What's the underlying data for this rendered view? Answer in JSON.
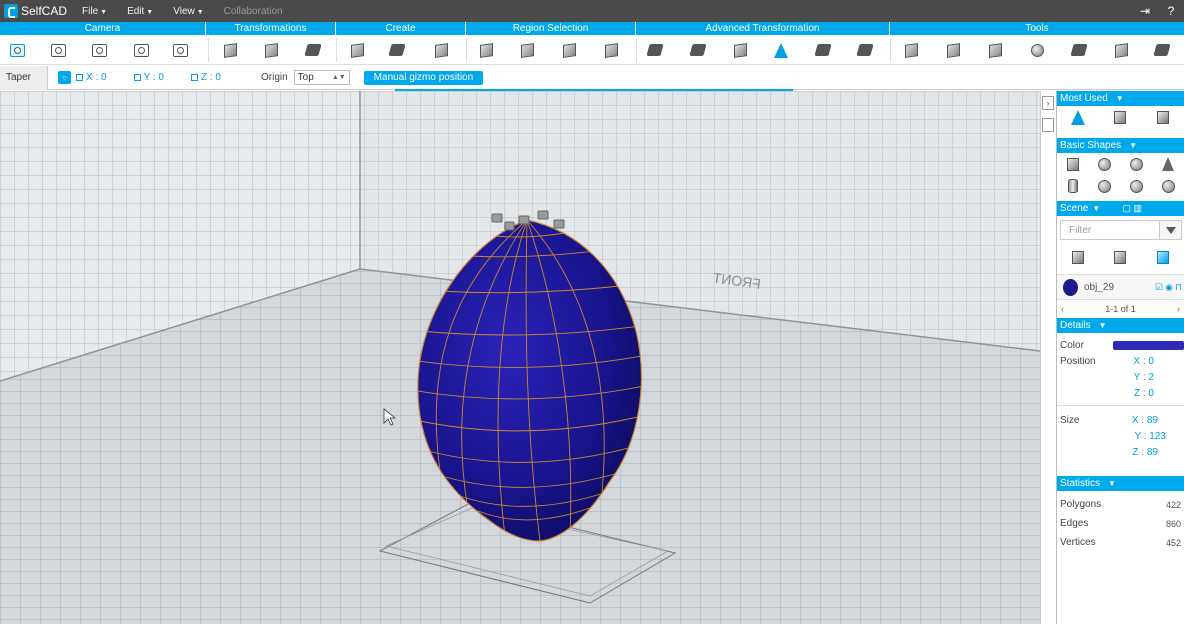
{
  "app": {
    "logo_text": "SelfCAD",
    "menu": [
      {
        "label": "File"
      },
      {
        "label": "Edit"
      },
      {
        "label": "View"
      },
      {
        "label": "Collaboration"
      }
    ]
  },
  "categories": [
    "Camera",
    "Transformations",
    "Create",
    "Region Selection",
    "Advanced Transformation",
    "Tools"
  ],
  "tool_options": {
    "tool_name": "Taper [J]",
    "axes": [
      "X : 0",
      "Y : 0",
      "Z : 0"
    ],
    "origin_label": "Origin",
    "origin_value": "Top",
    "gizmo_button": "Manual gizmo position"
  },
  "viewport": {
    "front_label": "FRONT"
  },
  "panel": {
    "most_used": "Most Used",
    "basic_shapes": "Basic Shapes",
    "scene": "Scene",
    "filter_placeholder": "Filter",
    "object_name": "obj_29",
    "pager_text": "1-1 of 1",
    "details": "Details",
    "color_label": "Color",
    "object_color": "#2d2ab8",
    "position_label": "Position",
    "position": {
      "x": "X : 0",
      "y": "Y : 2",
      "z": "Z : 0"
    },
    "size_label": "Size",
    "size": {
      "x": "X : 89",
      "y": "Y : 123",
      "z": "Z : 89"
    },
    "statistics": "Statistics",
    "polygons_label": "Polygons",
    "polygons": "422",
    "edges_label": "Edges",
    "edges": "860",
    "vertices_label": "Vertices",
    "vertices": "452"
  }
}
